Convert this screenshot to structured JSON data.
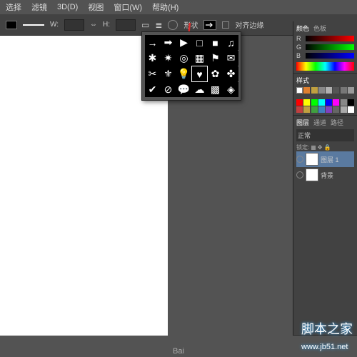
{
  "menu": {
    "select": "选择",
    "filter": "滤镜",
    "3d": "3D(D)",
    "view": "视图",
    "window": "窗口(W)",
    "help": "帮助(H)"
  },
  "optbar": {
    "w_lbl": "W:",
    "h_lbl": "H:",
    "shape_lbl": "形状",
    "align_lbl": "对齐边缘"
  },
  "panels": {
    "color": {
      "tab1": "颜色",
      "tab2": "色板",
      "r": "R",
      "g": "G",
      "b": "B"
    },
    "styles": {
      "tab1": "样式"
    },
    "layers": {
      "tab1": "图层",
      "tab2": "通道",
      "tab3": "路径",
      "blend": "正常",
      "lock_lbl": "锁定:",
      "layer1": "图层 1",
      "bg": "背景"
    }
  },
  "watermark": {
    "main": "脚本之家",
    "sub": "www.jb51.net",
    "baidu": "Bai"
  }
}
